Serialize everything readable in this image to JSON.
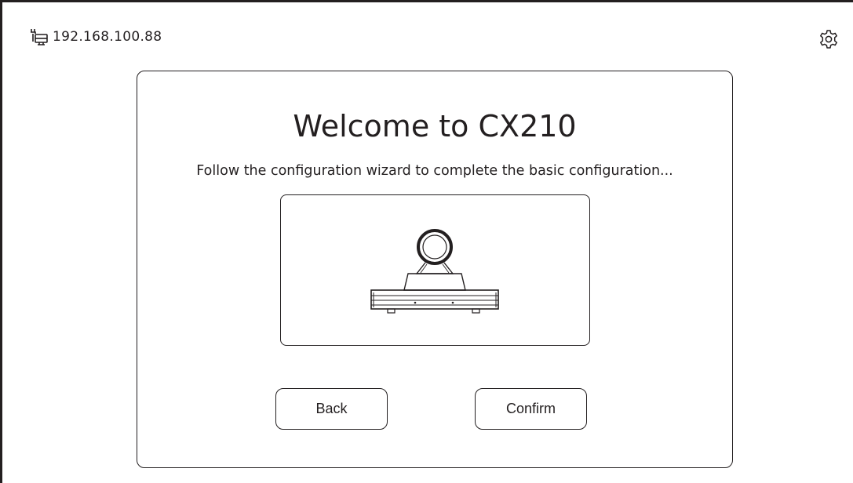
{
  "status_bar": {
    "ip_address": "192.168.100.88",
    "network_icon": "network-monitor-icon",
    "settings_icon": "gear-icon"
  },
  "wizard": {
    "title": "Welcome to CX210",
    "subtitle": "Follow the configuration wizard to complete the basic configuration...",
    "illustration": "camera-device-icon",
    "back_label": "Back",
    "confirm_label": "Confirm"
  }
}
